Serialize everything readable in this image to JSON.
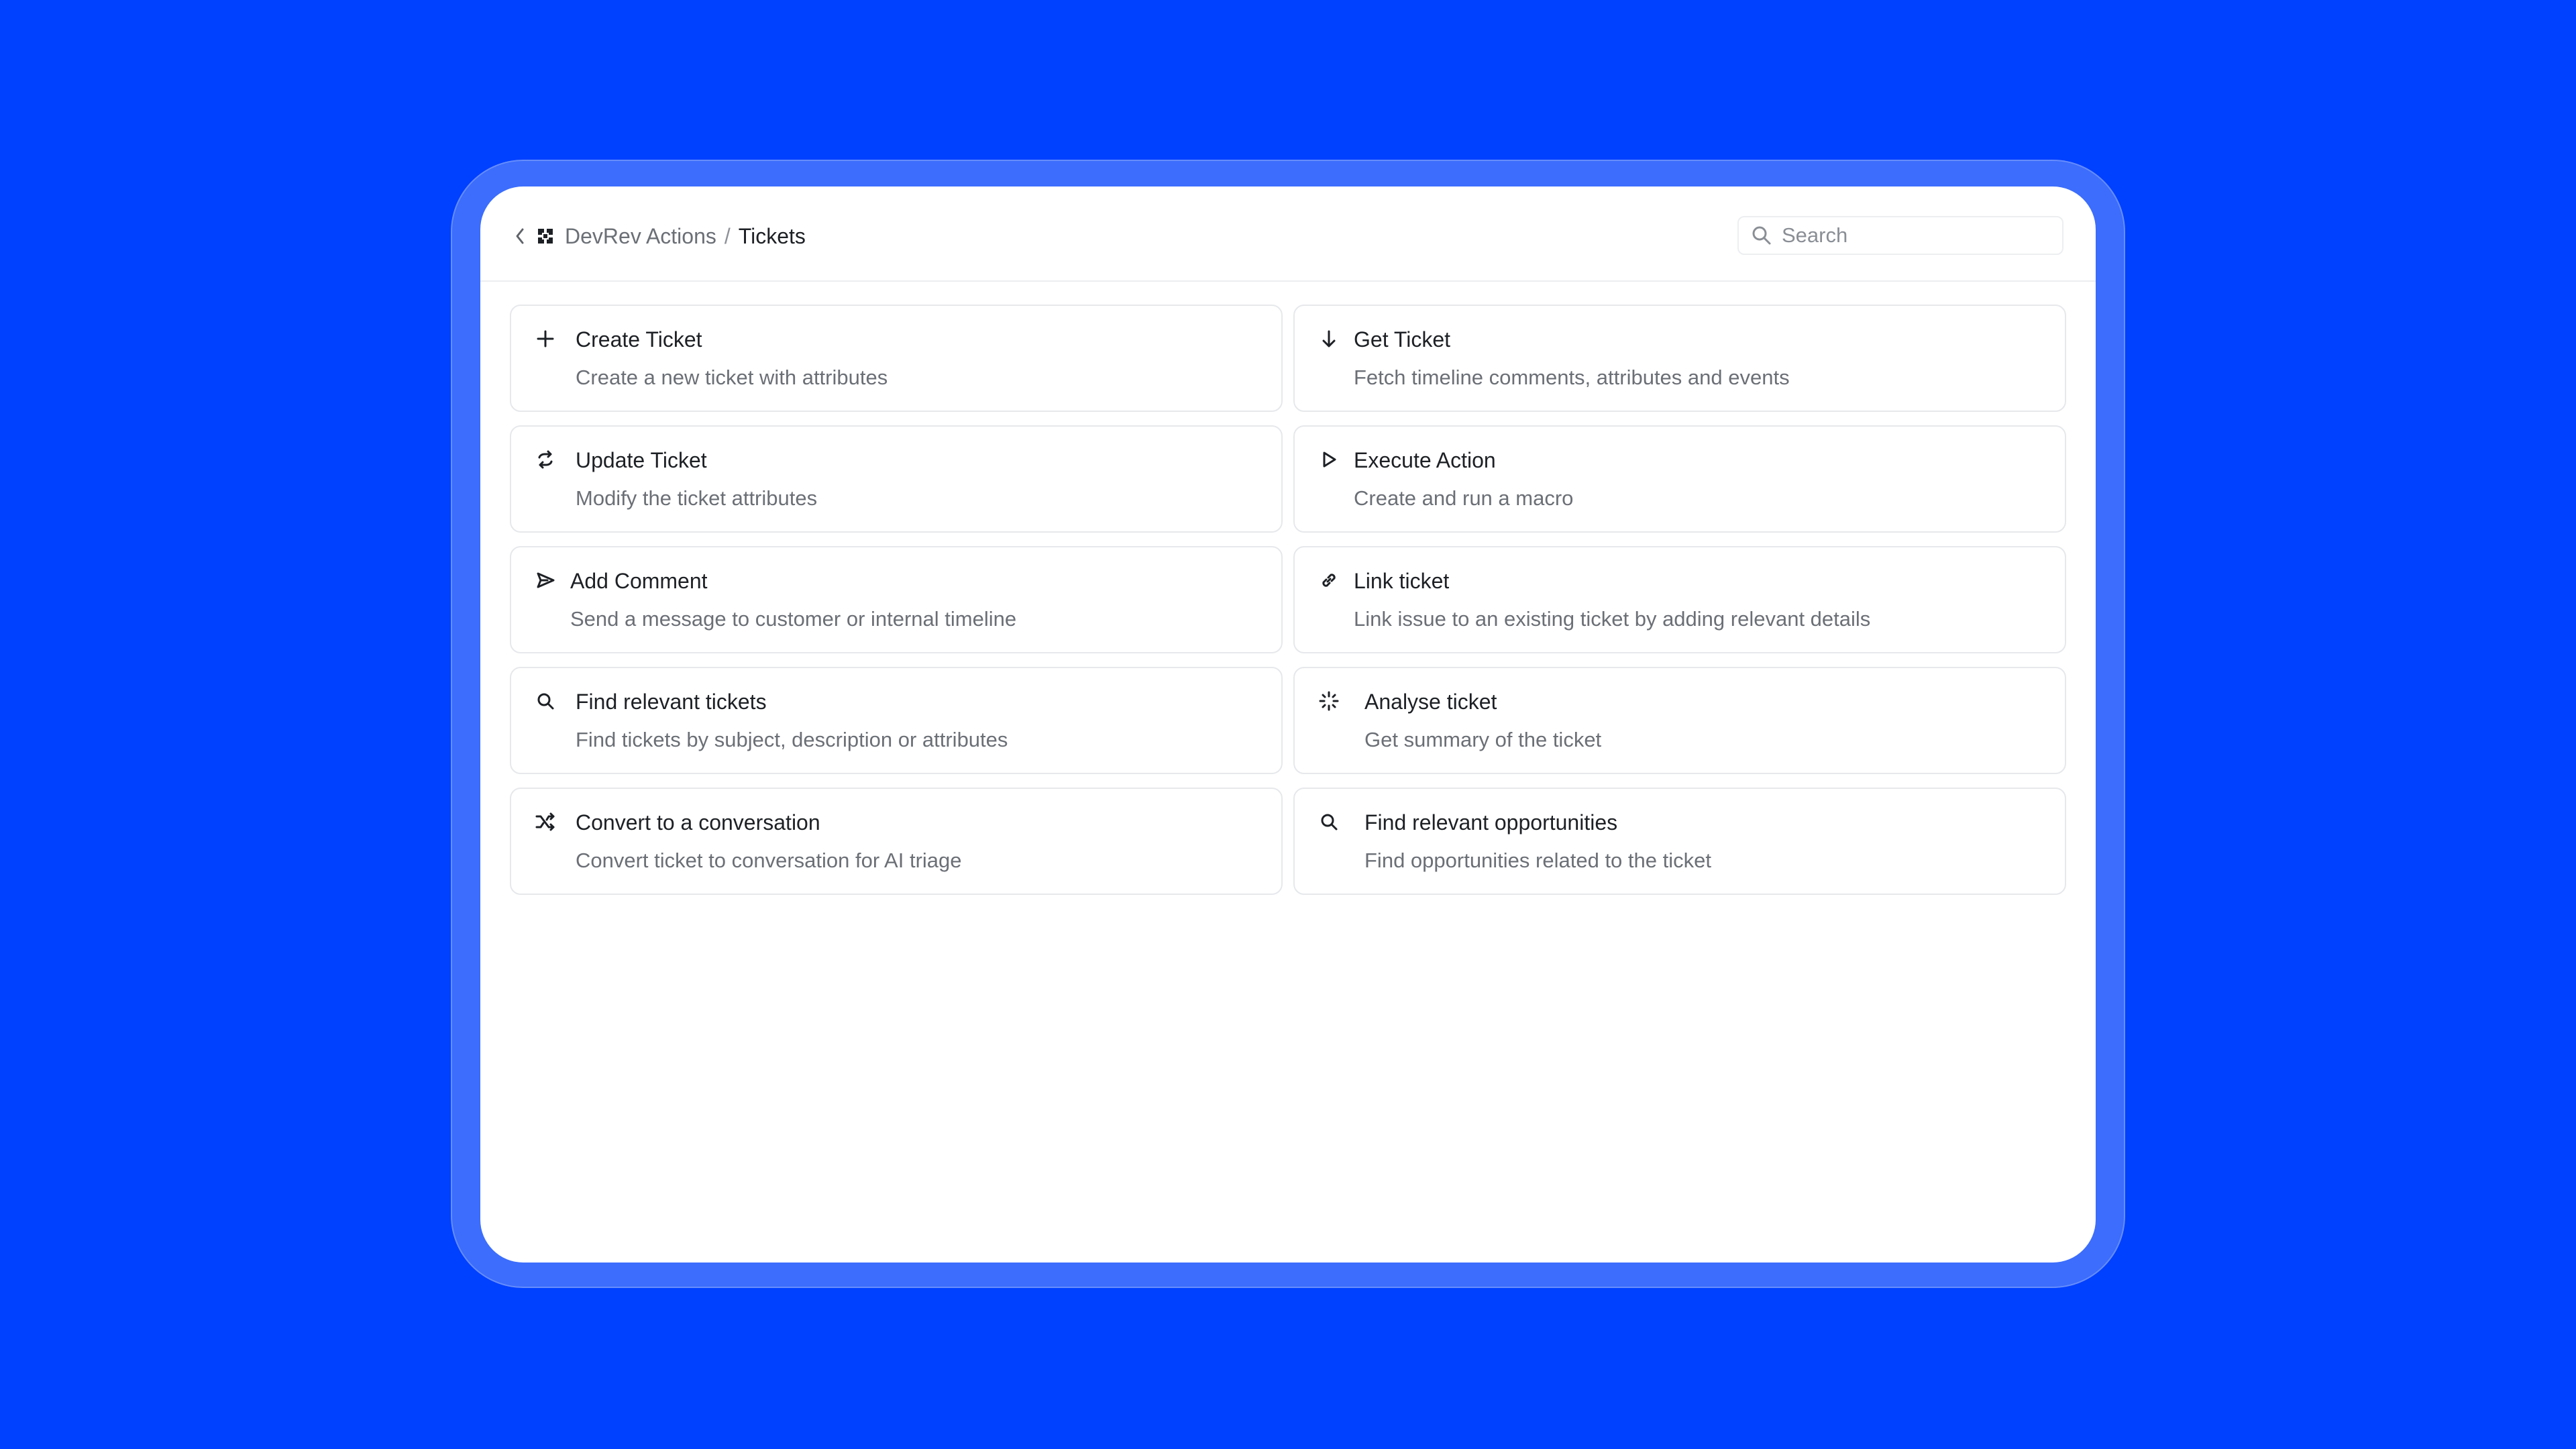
{
  "breadcrumb": {
    "parent": "DevRev Actions",
    "separator": "/",
    "current": "Tickets",
    "back_icon": "chevron-left-icon",
    "logo_icon": "devrev-logo-icon"
  },
  "search": {
    "placeholder": "Search",
    "value": "",
    "icon": "search-icon"
  },
  "actions": [
    {
      "title": "Create Ticket",
      "description": "Create a new ticket with attributes",
      "icon": "plus-icon"
    },
    {
      "title": "Get Ticket",
      "description": "Fetch timeline comments, attributes and events",
      "icon": "arrow-down-icon"
    },
    {
      "title": "Update Ticket",
      "description": "Modify the ticket attributes",
      "icon": "refresh-icon"
    },
    {
      "title": "Execute Action",
      "description": "Create and run a macro",
      "icon": "play-icon"
    },
    {
      "title": "Add Comment",
      "description": "Send a message to customer or internal timeline",
      "icon": "send-icon"
    },
    {
      "title": "Link ticket",
      "description": "Link issue to an existing ticket by adding relevant details",
      "icon": "link-icon"
    },
    {
      "title": "Find relevant tickets",
      "description": "Find tickets by subject, description or attributes",
      "icon": "search-icon"
    },
    {
      "title": "Analyse ticket",
      "description": "Get summary of the ticket",
      "icon": "sparkle-loader-icon"
    },
    {
      "title": "Convert to a conversation",
      "description": "Convert ticket to conversation for AI triage",
      "icon": "shuffle-icon"
    },
    {
      "title": "Find relevant opportunities",
      "description": "Find opportunities related to the ticket",
      "icon": "search-icon"
    }
  ],
  "colors": {
    "background": "#0040ff",
    "frame": "#3c6dfc",
    "panel": "#ffffff",
    "title_text": "#1d2024",
    "secondary_text": "#6b6f76",
    "border": "#e6e8eb"
  }
}
